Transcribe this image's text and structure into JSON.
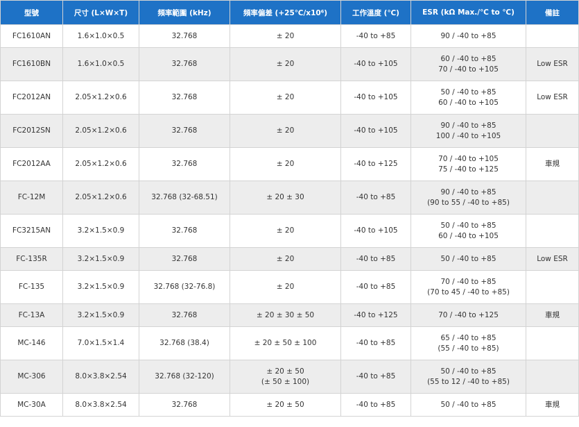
{
  "table": {
    "headers": [
      "型號",
      "尺寸 (L×W×T)",
      "頻率範圍 (kHz)",
      "頻率偏差 (+25℃/x10⁶)",
      "工作溫度 (℃)",
      "ESR (kΩ Max./℃ to ℃)",
      "備註"
    ],
    "rows": [
      {
        "model": "FC1610AN",
        "size": "1.6×1.0×0.5",
        "freq": "32.768",
        "tol": [
          "± 20"
        ],
        "temp": "-40 to +85",
        "esr": [
          "90 / -40 to +85"
        ],
        "note": ""
      },
      {
        "model": "FC1610BN",
        "size": "1.6×1.0×0.5",
        "freq": "32.768",
        "tol": [
          "± 20"
        ],
        "temp": "-40 to +105",
        "esr": [
          "60 / -40 to +85",
          "70 / -40 to +105"
        ],
        "note": "Low ESR"
      },
      {
        "model": "FC2012AN",
        "size": "2.05×1.2×0.6",
        "freq": "32.768",
        "tol": [
          "± 20"
        ],
        "temp": "-40 to +105",
        "esr": [
          "50 / -40 to +85",
          "60 / -40 to +105"
        ],
        "note": "Low ESR"
      },
      {
        "model": "FC2012SN",
        "size": "2.05×1.2×0.6",
        "freq": "32.768",
        "tol": [
          "± 20"
        ],
        "temp": "-40 to +105",
        "esr": [
          "90 / -40 to +85",
          "100 / -40 to +105"
        ],
        "note": ""
      },
      {
        "model": "FC2012AA",
        "size": "2.05×1.2×0.6",
        "freq": "32.768",
        "tol": [
          "± 20"
        ],
        "temp": "-40 to +125",
        "esr": [
          "70 / -40 to +105",
          "75 / -40 to +125"
        ],
        "note": "車規"
      },
      {
        "model": "FC-12M",
        "size": "2.05×1.2×0.6",
        "freq": "32.768 (32-68.51)",
        "tol": [
          "± 20 ± 30"
        ],
        "temp": "-40 to +85",
        "esr": [
          "90 / -40 to +85",
          "(90 to 55 / -40 to +85)"
        ],
        "note": ""
      },
      {
        "model": "FC3215AN",
        "size": "3.2×1.5×0.9",
        "freq": "32.768",
        "tol": [
          "± 20"
        ],
        "temp": "-40 to +105",
        "esr": [
          "50 / -40 to +85",
          "60 / -40 to +105"
        ],
        "note": ""
      },
      {
        "model": "FC-135R",
        "size": "3.2×1.5×0.9",
        "freq": "32.768",
        "tol": [
          "± 20"
        ],
        "temp": "-40 to +85",
        "esr": [
          "50 / -40 to +85"
        ],
        "note": "Low ESR"
      },
      {
        "model": "FC-135",
        "size": "3.2×1.5×0.9",
        "freq": "32.768 (32-76.8)",
        "tol": [
          "± 20"
        ],
        "temp": "-40 to +85",
        "esr": [
          "70 / -40 to +85",
          "(70 to 45 / -40 to +85)"
        ],
        "note": ""
      },
      {
        "model": "FC-13A",
        "size": "3.2×1.5×0.9",
        "freq": "32.768",
        "tol": [
          "± 20 ± 30 ± 50"
        ],
        "temp": "-40 to +125",
        "esr": [
          "70 / -40 to +125"
        ],
        "note": "車規"
      },
      {
        "model": "MC-146",
        "size": "7.0×1.5×1.4",
        "freq": "32.768 (38.4)",
        "tol": [
          "± 20 ± 50 ± 100"
        ],
        "temp": "-40 to +85",
        "esr": [
          "65 / -40 to +85",
          "(55 / -40 to +85)"
        ],
        "note": ""
      },
      {
        "model": "MC-306",
        "size": "8.0×3.8×2.54",
        "freq": "32.768 (32-120)",
        "tol": [
          "± 20 ± 50",
          "(± 50 ± 100)"
        ],
        "temp": "-40 to +85",
        "esr": [
          "50 / -40 to +85",
          "(55 to 12 / -40 to +85)"
        ],
        "note": ""
      },
      {
        "model": "MC-30A",
        "size": "8.0×3.8×2.54",
        "freq": "32.768",
        "tol": [
          "± 20 ± 50"
        ],
        "temp": "-40 to +85",
        "esr": [
          "50 / -40 to +85"
        ],
        "note": "車規"
      }
    ]
  }
}
